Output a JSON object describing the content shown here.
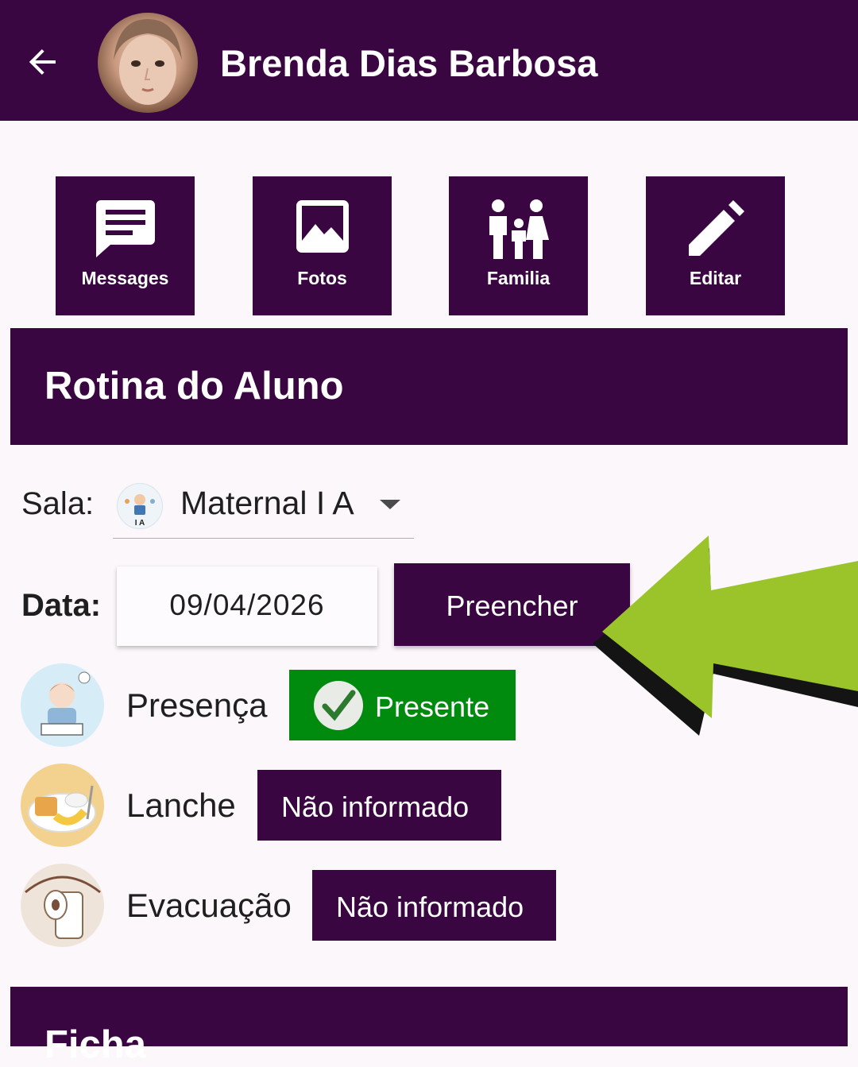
{
  "header": {
    "title": "Brenda Dias Barbosa",
    "back_icon": "arrow-back-icon"
  },
  "actions": [
    {
      "label": "Messages",
      "icon": "message-icon"
    },
    {
      "label": "Fotos",
      "icon": "image-icon"
    },
    {
      "label": "Familia",
      "icon": "family-icon"
    },
    {
      "label": "Editar",
      "icon": "pencil-icon"
    }
  ],
  "routine": {
    "section_title": "Rotina do Aluno",
    "sala_label": "Sala:",
    "sala_value": "Maternal I A",
    "sala_icon_text": "I A",
    "data_label": "Data:",
    "date_value": "09/04/2026",
    "fill_button": "Preencher",
    "items": [
      {
        "label": "Presença",
        "status": "Presente",
        "status_color": "#008a0e"
      },
      {
        "label": "Lanche",
        "status": "Não informado",
        "status_color": "#3a0641"
      },
      {
        "label": "Evacuação",
        "status": "Não informado",
        "status_color": "#3a0641"
      }
    ]
  },
  "ficha": {
    "section_title": "Ficha"
  },
  "colors": {
    "primary": "#3a0641",
    "background": "#fcf7fa",
    "present": "#008a0e",
    "arrow": "#9ac42a"
  }
}
